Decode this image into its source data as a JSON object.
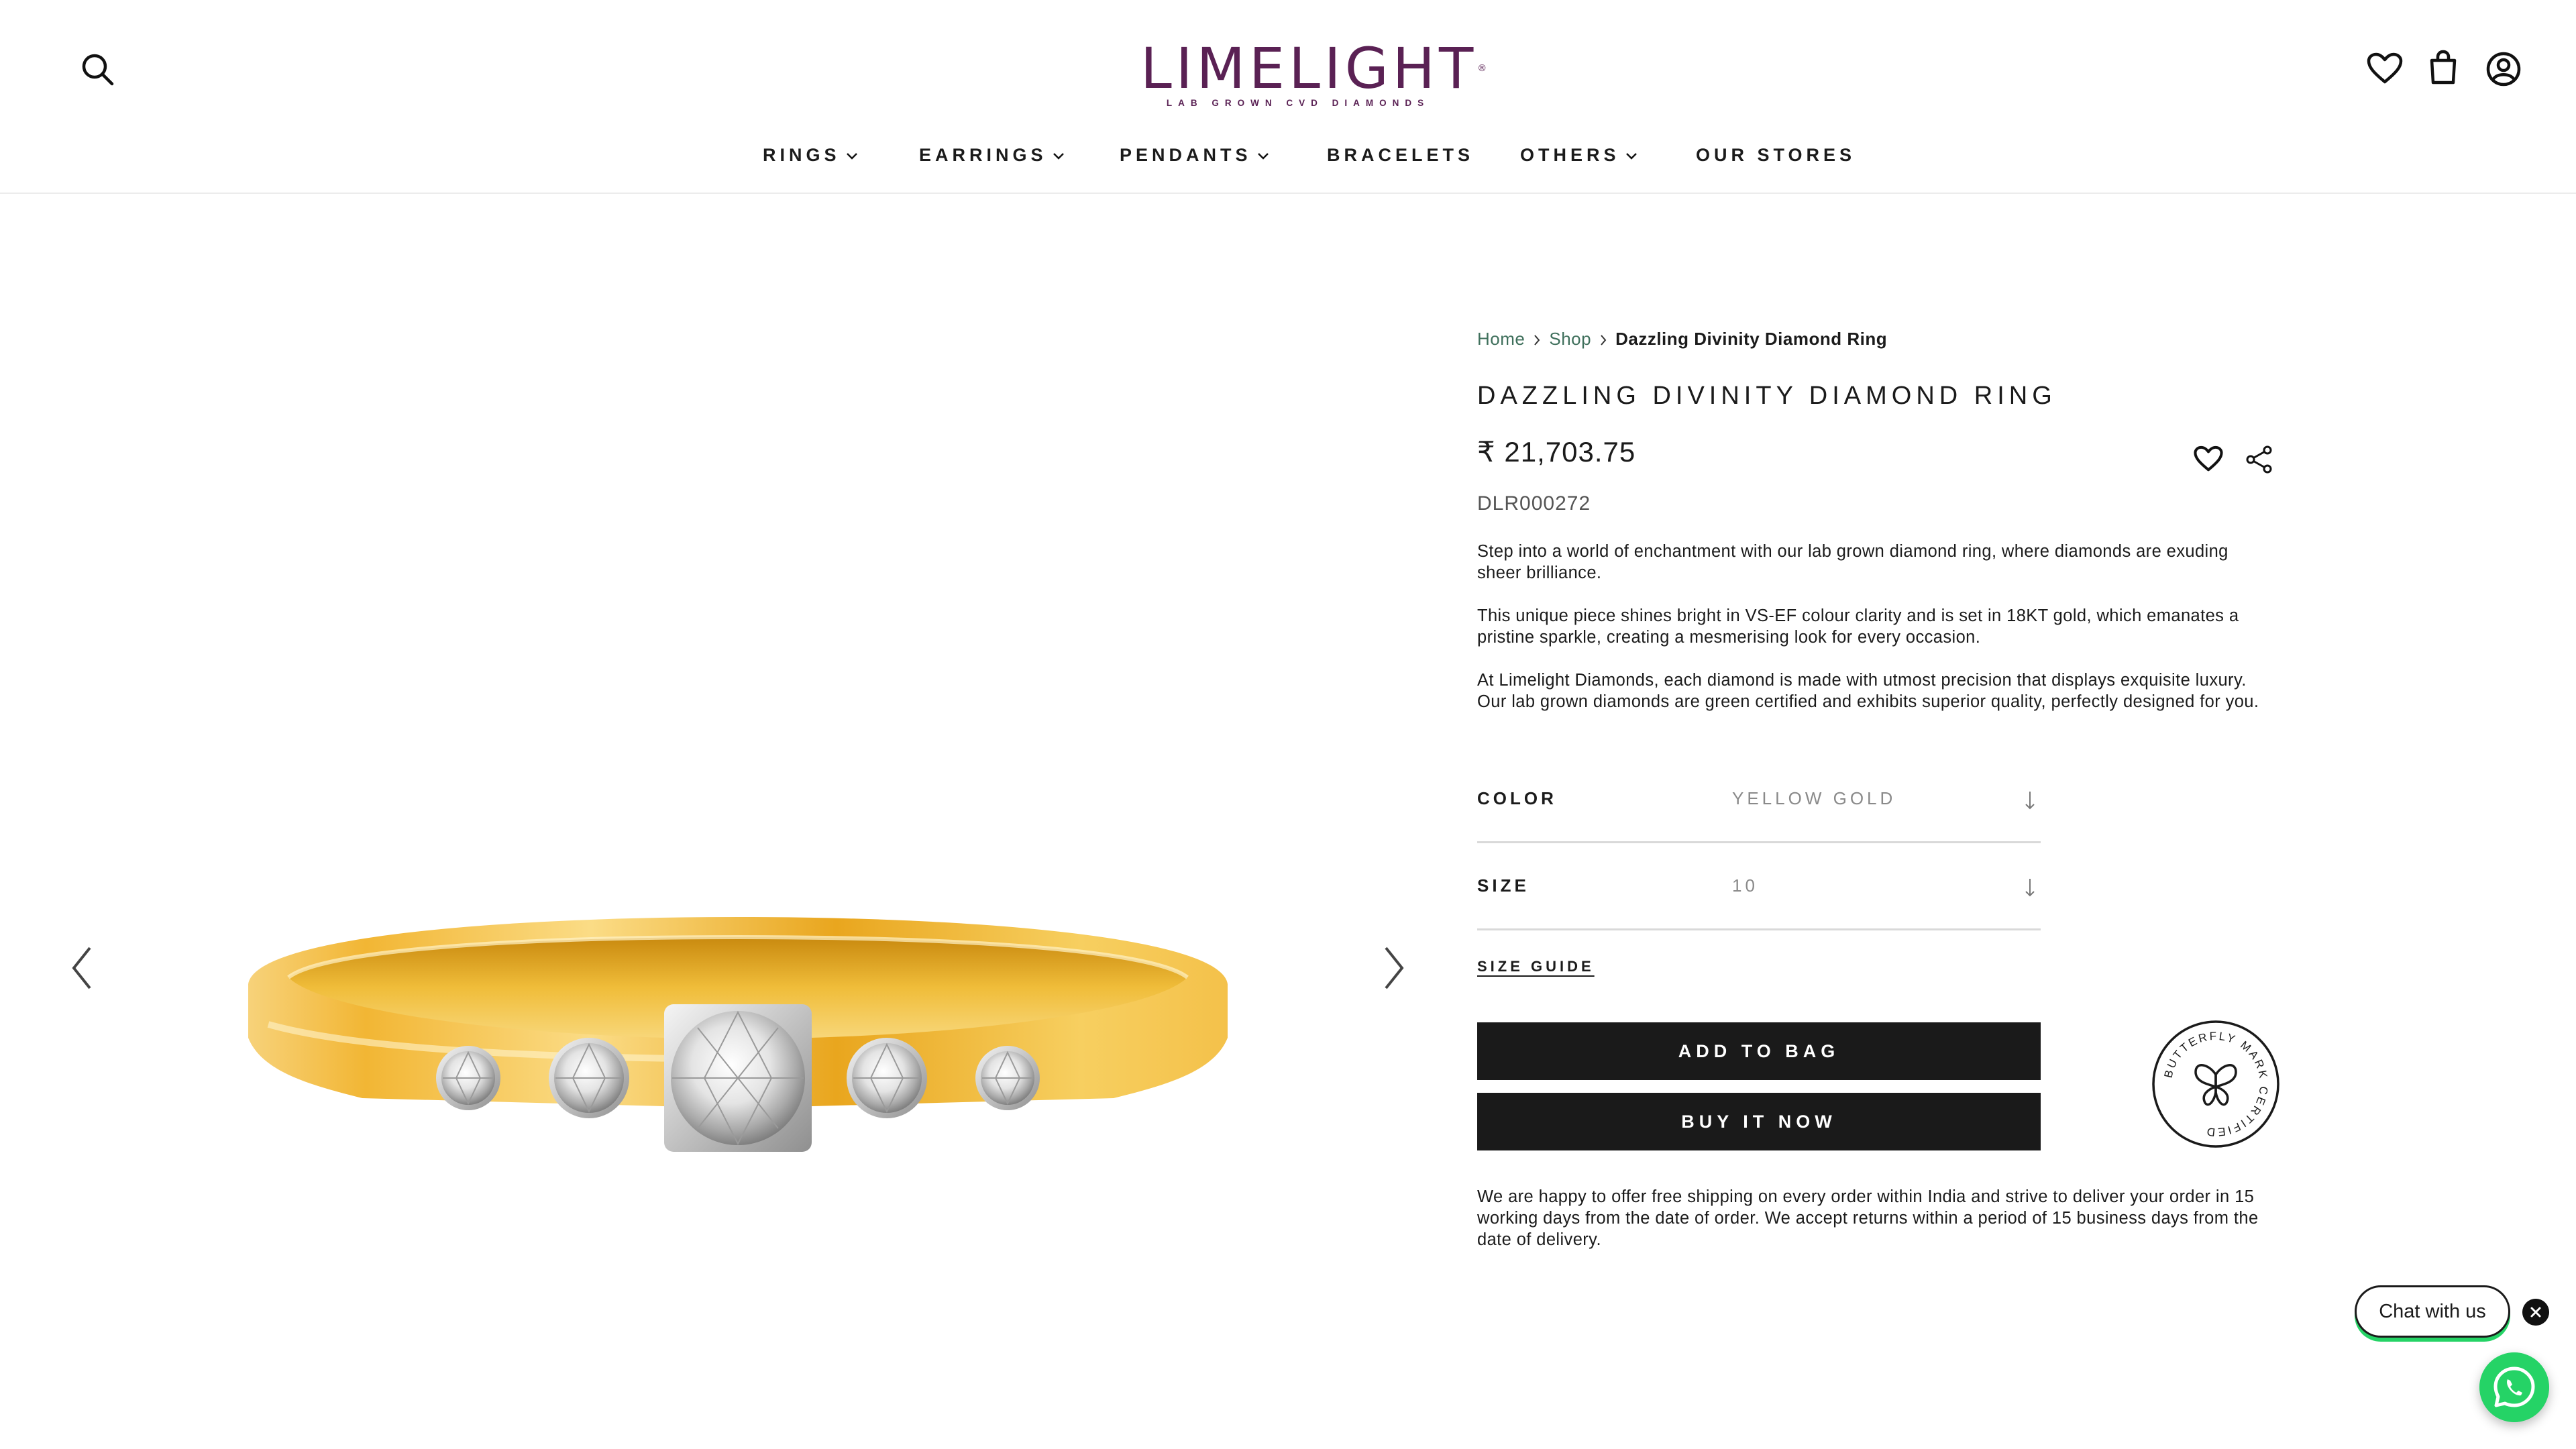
{
  "header": {
    "logo_text": "LIMELIGHT",
    "logo_registered": "®",
    "logo_tagline": "LAB GROWN CVD DIAMONDS",
    "brand_color": "#5a2154",
    "icons": [
      "search-icon",
      "heart-icon",
      "bag-icon",
      "account-icon"
    ]
  },
  "nav": {
    "items": [
      {
        "label": "RINGS",
        "has_dropdown": true
      },
      {
        "label": "EARRINGS",
        "has_dropdown": true
      },
      {
        "label": "PENDANTS",
        "has_dropdown": true
      },
      {
        "label": "BRACELETS",
        "has_dropdown": false
      },
      {
        "label": "OTHERS",
        "has_dropdown": true
      },
      {
        "label": "OUR STORES",
        "has_dropdown": false
      }
    ]
  },
  "breadcrumb": {
    "home": "Home",
    "shop": "Shop",
    "current": "Dazzling Divinity Diamond Ring"
  },
  "product": {
    "title": "DAZZLING DIVINITY DIAMOND RING",
    "price": "₹ 21,703.75",
    "sku": "DLR000272",
    "description": [
      "Step into a world of enchantment with our lab grown diamond ring, where diamonds are exuding sheer brilliance.",
      "This unique piece shines bright in VS-EF colour clarity and is set in 18KT gold, which emanates a pristine sparkle, creating a mesmerising look for every occasion.",
      "At Limelight Diamonds, each diamond is made with utmost precision that displays exquisite luxury. Our lab grown diamonds are green certified and exhibits superior quality, perfectly designed for you."
    ],
    "options": {
      "color": {
        "label": "COLOR",
        "value": "YELLOW GOLD"
      },
      "size": {
        "label": "SIZE",
        "value": "10"
      }
    },
    "size_guide": "SIZE GUIDE",
    "add_to_bag": "ADD TO BAG",
    "buy_now": "BUY IT NOW",
    "badge_text": "BUTTERFLY MARK CERTIFIED",
    "shipping": "We are happy to offer free shipping on every order within India and strive to deliver your order in 15 working days from the date of order. We accept returns within a period of 15 business days from the date of delivery."
  },
  "chat": {
    "label": "Chat with us",
    "accent": "#25d366"
  }
}
